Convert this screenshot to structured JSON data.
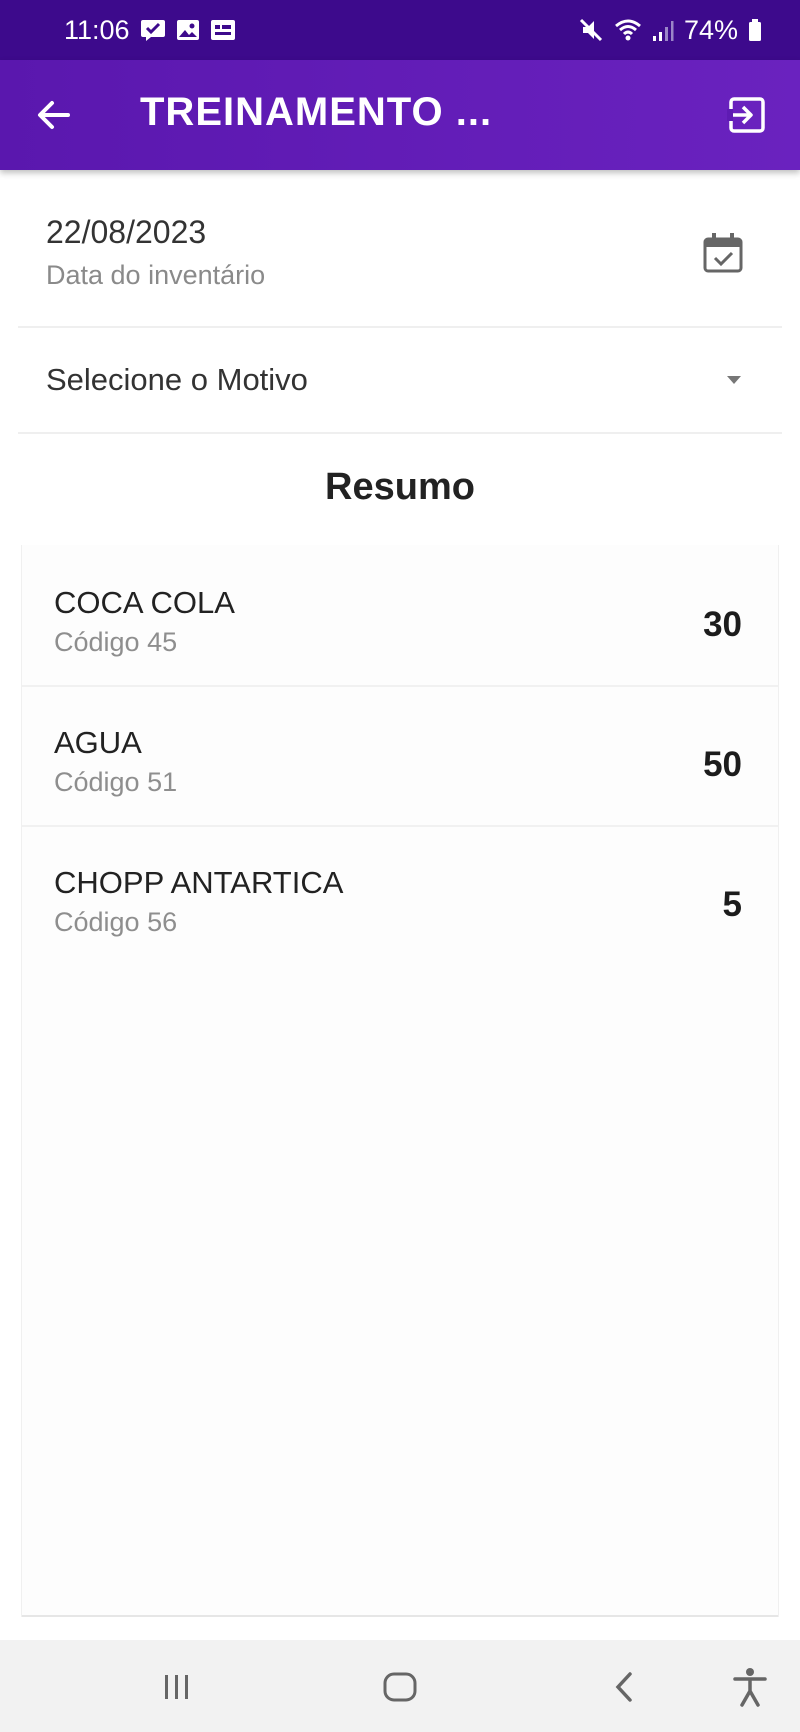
{
  "status_bar": {
    "time": "11:06",
    "battery": "74%",
    "icons_left": [
      "message-icon",
      "gallery-icon",
      "sms-icon"
    ],
    "icons_right": [
      "mute-icon",
      "wifi-icon",
      "signal-icon",
      "battery-icon"
    ]
  },
  "app_bar": {
    "title": "TREINAMENTO ...",
    "back_icon": "back-arrow-icon",
    "exit_icon": "exit-icon",
    "color": "#5b1ab0"
  },
  "date_field": {
    "value": "22/08/2023",
    "label": "Data do inventário",
    "icon": "calendar-check-icon"
  },
  "motivo_select": {
    "placeholder": "Selecione o Motivo",
    "icon": "dropdown-arrow-icon"
  },
  "summary": {
    "title": "Resumo",
    "items": [
      {
        "name": "COCA COLA",
        "code": "Código 45",
        "quantity": "30"
      },
      {
        "name": "AGUA",
        "code": "Código 51",
        "quantity": "50"
      },
      {
        "name": "CHOPP ANTARTICA",
        "code": "Código 56",
        "quantity": "5"
      }
    ]
  },
  "nav_bar": {
    "buttons": [
      "recent-apps-icon",
      "home-icon",
      "back-icon",
      "accessibility-icon"
    ]
  }
}
